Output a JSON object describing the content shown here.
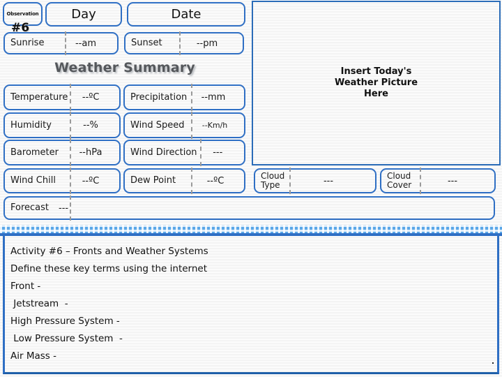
{
  "observation": {
    "label": "Observation",
    "number": "#6"
  },
  "header": {
    "day_label": "Day",
    "date_label": "Date"
  },
  "sun": [
    {
      "label": "Sunrise",
      "value": "--am"
    },
    {
      "label": "Sunset",
      "value": "--pm"
    }
  ],
  "summary_title": "Weather Summary",
  "fields": [
    {
      "label": "Temperature",
      "value": "--ºC"
    },
    {
      "label": "Precipitation",
      "value": "--mm"
    },
    {
      "label": "Humidity",
      "value": "--%"
    },
    {
      "label": "Wind Speed",
      "value": "--Km/h"
    },
    {
      "label": "Barometer",
      "value": "--hPa"
    },
    {
      "label": "Wind Direction",
      "value": "---"
    },
    {
      "label": "Wind Chill",
      "value": "--ºC"
    },
    {
      "label": "Dew Point",
      "value": "--ºC"
    }
  ],
  "forecast": {
    "label": "Forecast",
    "value": "---"
  },
  "cloud": [
    {
      "label_line1": "Cloud",
      "label_line2": "Type",
      "value": "---"
    },
    {
      "label_line1": "Cloud",
      "label_line2": "Cover",
      "value": "---"
    }
  ],
  "picture_placeholder": {
    "line1": "Insert Today's",
    "line2": "Weather Picture",
    "line3": "Here"
  },
  "activity": {
    "lines": [
      "Activity #6 – Fronts and Weather Systems",
      "Define these key terms using the internet",
      "Front -",
      " Jetstream  -",
      "High Pressure System -",
      " Low Pressure System  -",
      "Air Mass -"
    ]
  },
  "colors": {
    "pill_border": "#2f6fc4",
    "band": "#5aa7e8",
    "picture_border": "#2b6cb8",
    "title_text": "#55585c"
  }
}
